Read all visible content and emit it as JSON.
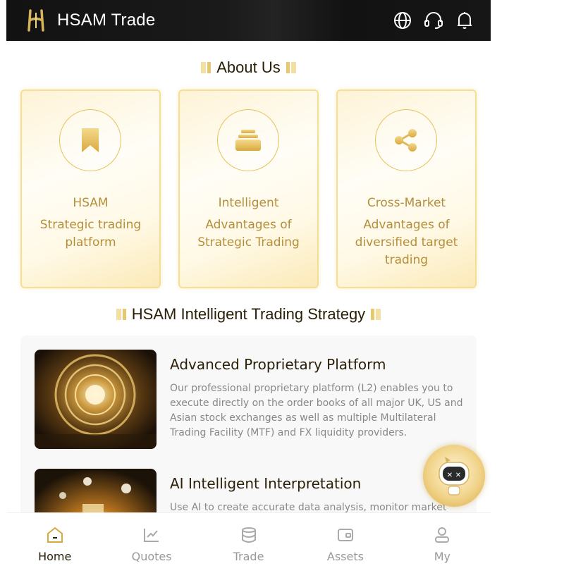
{
  "header": {
    "brand": "HSAM Trade",
    "icons": [
      "globe-icon",
      "headset-icon",
      "bell-icon"
    ]
  },
  "about": {
    "title": "About Us",
    "cards": [
      {
        "icon": "bookmark-icon",
        "title": "HSAM",
        "desc": "Strategic trading platform"
      },
      {
        "icon": "stack-icon",
        "title": "Intelligent",
        "desc": "Advantages of Strategic Trading"
      },
      {
        "icon": "share-icon",
        "title": "Cross-Market",
        "desc": "Advantages of diversified target trading"
      }
    ]
  },
  "strategy": {
    "title": "HSAM Intelligent Trading Strategy",
    "items": [
      {
        "title": "Advanced Proprietary Platform",
        "desc": "Our professional proprietary platform (L2) enables you to execute directly on the order books of all major UK, US and Asian stock exchanges as well as multiple Multilateral Trading Facility (MTF) and FX liquidity providers."
      },
      {
        "title": "AI Intelligent Interpretation",
        "desc": "Use AI to create accurate data analysis, monitor market"
      }
    ]
  },
  "nav": {
    "items": [
      {
        "label": "Home",
        "icon": "home-icon",
        "active": true
      },
      {
        "label": "Quotes",
        "icon": "chart-icon",
        "active": false
      },
      {
        "label": "Trade",
        "icon": "coins-icon",
        "active": false
      },
      {
        "label": "Assets",
        "icon": "wallet-icon",
        "active": false
      },
      {
        "label": "My",
        "icon": "user-icon",
        "active": false
      }
    ]
  },
  "colors": {
    "accent": "#e6c257",
    "text_gold": "#b58e3a",
    "header_bg": "#121212"
  }
}
